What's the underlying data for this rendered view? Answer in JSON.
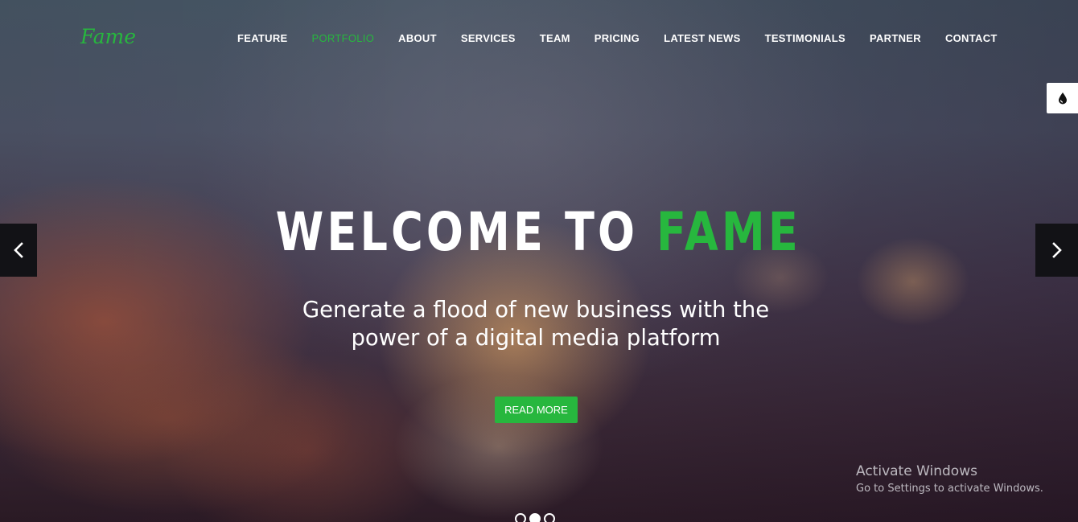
{
  "brand": {
    "logo": "Fame",
    "accent_color": "#27b73e"
  },
  "nav": {
    "items": [
      {
        "label": "FEATURE"
      },
      {
        "label": "PORTFOLIO",
        "active": true
      },
      {
        "label": "ABOUT"
      },
      {
        "label": "SERVICES"
      },
      {
        "label": "TEAM"
      },
      {
        "label": "PRICING"
      },
      {
        "label": "LATEST NEWS"
      },
      {
        "label": "TESTIMONIALS"
      },
      {
        "label": "PARTNER"
      },
      {
        "label": "CONTACT"
      }
    ]
  },
  "style_switcher": {
    "icon": "droplet-icon"
  },
  "slider": {
    "prev_icon": "chevron-left-icon",
    "next_icon": "chevron-right-icon",
    "headline_white": "WELCOME TO",
    "headline_accent": "FAME",
    "subtitle_line1": "Generate a flood of new business with the",
    "subtitle_line2": "power of a digital media platform",
    "cta_label": "READ MORE",
    "slide_count": 3,
    "active_slide": 2
  },
  "watermark": {
    "title": "Activate Windows",
    "subtitle": "Go to Settings to activate Windows."
  }
}
